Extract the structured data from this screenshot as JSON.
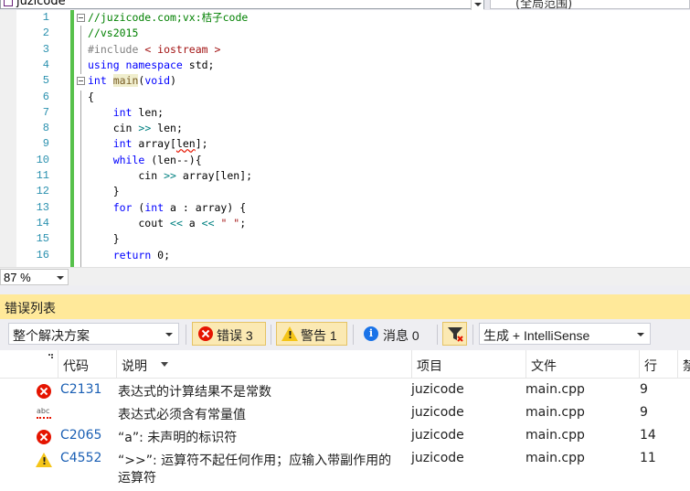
{
  "topbar": {
    "project_combo": "juzicode",
    "scope_combo": "(全局范围)"
  },
  "editor": {
    "lines": [
      {
        "n": "1",
        "tokens": [
          {
            "t": "//juzicode.com;vx:桔子code",
            "c": "cm"
          }
        ]
      },
      {
        "n": "2",
        "tokens": [
          {
            "t": "//vs2015",
            "c": "cm"
          }
        ]
      },
      {
        "n": "3",
        "tokens": [
          {
            "t": "#include ",
            "c": "pp"
          },
          {
            "t": "< iostream >",
            "c": "st"
          }
        ]
      },
      {
        "n": "4",
        "tokens": [
          {
            "t": "using namespace",
            "c": "kw"
          },
          {
            "t": " std;",
            "c": ""
          }
        ]
      },
      {
        "n": "5",
        "tokens": [
          {
            "t": "int",
            "c": "kw"
          },
          {
            "t": " ",
            "c": ""
          },
          {
            "t": "main",
            "c": "fn"
          },
          {
            "t": "(",
            "c": ""
          },
          {
            "t": "void",
            "c": "kw"
          },
          {
            "t": ")",
            "c": ""
          }
        ]
      },
      {
        "n": "6",
        "tokens": [
          {
            "t": "{",
            "c": ""
          }
        ]
      },
      {
        "n": "7",
        "tokens": [
          {
            "t": "    ",
            "c": ""
          },
          {
            "t": "int",
            "c": "kw"
          },
          {
            "t": " len;",
            "c": ""
          }
        ]
      },
      {
        "n": "8",
        "tokens": [
          {
            "t": "    cin ",
            "c": ""
          },
          {
            "t": ">>",
            "c": "op"
          },
          {
            "t": " len;",
            "c": ""
          }
        ]
      },
      {
        "n": "9",
        "tokens": [
          {
            "t": "    ",
            "c": ""
          },
          {
            "t": "int",
            "c": "kw"
          },
          {
            "t": " array[",
            "c": ""
          },
          {
            "t": "len",
            "c": "squig"
          },
          {
            "t": "];",
            "c": ""
          }
        ]
      },
      {
        "n": "10",
        "tokens": [
          {
            "t": "    ",
            "c": ""
          },
          {
            "t": "while",
            "c": "kw"
          },
          {
            "t": " (len--){",
            "c": ""
          }
        ]
      },
      {
        "n": "11",
        "tokens": [
          {
            "t": "        cin ",
            "c": ""
          },
          {
            "t": ">>",
            "c": "op"
          },
          {
            "t": " array[len];",
            "c": ""
          }
        ]
      },
      {
        "n": "12",
        "tokens": [
          {
            "t": "    }",
            "c": ""
          }
        ]
      },
      {
        "n": "13",
        "tokens": [
          {
            "t": "    ",
            "c": ""
          },
          {
            "t": "for",
            "c": "kw"
          },
          {
            "t": " (",
            "c": ""
          },
          {
            "t": "int",
            "c": "kw"
          },
          {
            "t": " a : array) {",
            "c": ""
          }
        ]
      },
      {
        "n": "14",
        "tokens": [
          {
            "t": "        cout ",
            "c": ""
          },
          {
            "t": "<<",
            "c": "op"
          },
          {
            "t": " a ",
            "c": ""
          },
          {
            "t": "<<",
            "c": "op"
          },
          {
            "t": " ",
            "c": ""
          },
          {
            "t": "\" \"",
            "c": "st"
          },
          {
            "t": ";",
            "c": ""
          }
        ]
      },
      {
        "n": "15",
        "tokens": [
          {
            "t": "    }",
            "c": ""
          }
        ]
      },
      {
        "n": "16",
        "tokens": [
          {
            "t": "    ",
            "c": ""
          },
          {
            "t": "return",
            "c": "kw"
          },
          {
            "t": " 0;",
            "c": ""
          }
        ]
      }
    ]
  },
  "status": {
    "zoom": "87 %"
  },
  "panel": {
    "title": "错误列表",
    "scope_filter": "整个解决方案",
    "errors_btn": "错误 3",
    "warnings_btn": "警告 1",
    "messages_btn": "消息 0",
    "build_filter": "生成 + IntelliSense"
  },
  "table": {
    "headers": {
      "code": "代码",
      "description": "说明",
      "project": "项目",
      "file": "文件",
      "line": "行",
      "suppress": "禁"
    },
    "rows": [
      {
        "icon": "error-icon",
        "code": "C2131",
        "desc": "表达式的计算结果不是常数",
        "desc2": "",
        "project": "juzicode",
        "file": "main.cpp",
        "line": "9"
      },
      {
        "icon": "intellisense-error-icon",
        "code": "",
        "desc": "表达式必须含有常量值",
        "desc2": "",
        "project": "juzicode",
        "file": "main.cpp",
        "line": "9"
      },
      {
        "icon": "error-icon",
        "code": "C2065",
        "desc": "“a”: 未声明的标识符",
        "desc2": "",
        "project": "juzicode",
        "file": "main.cpp",
        "line": "14"
      },
      {
        "icon": "warning-icon",
        "code": "C4552",
        "desc": "“>>”: 运算符不起任何作用；应输入带副作用的",
        "desc2": "运算符",
        "project": "juzicode",
        "file": "main.cpp",
        "line": "11"
      }
    ]
  },
  "colors": {
    "panel_title_bg": "#ffe99a",
    "error": "#e51400",
    "warning": "#f5c518",
    "info": "#1a73e8",
    "link": "#1a5fb4",
    "change_bar": "#57c14b"
  }
}
